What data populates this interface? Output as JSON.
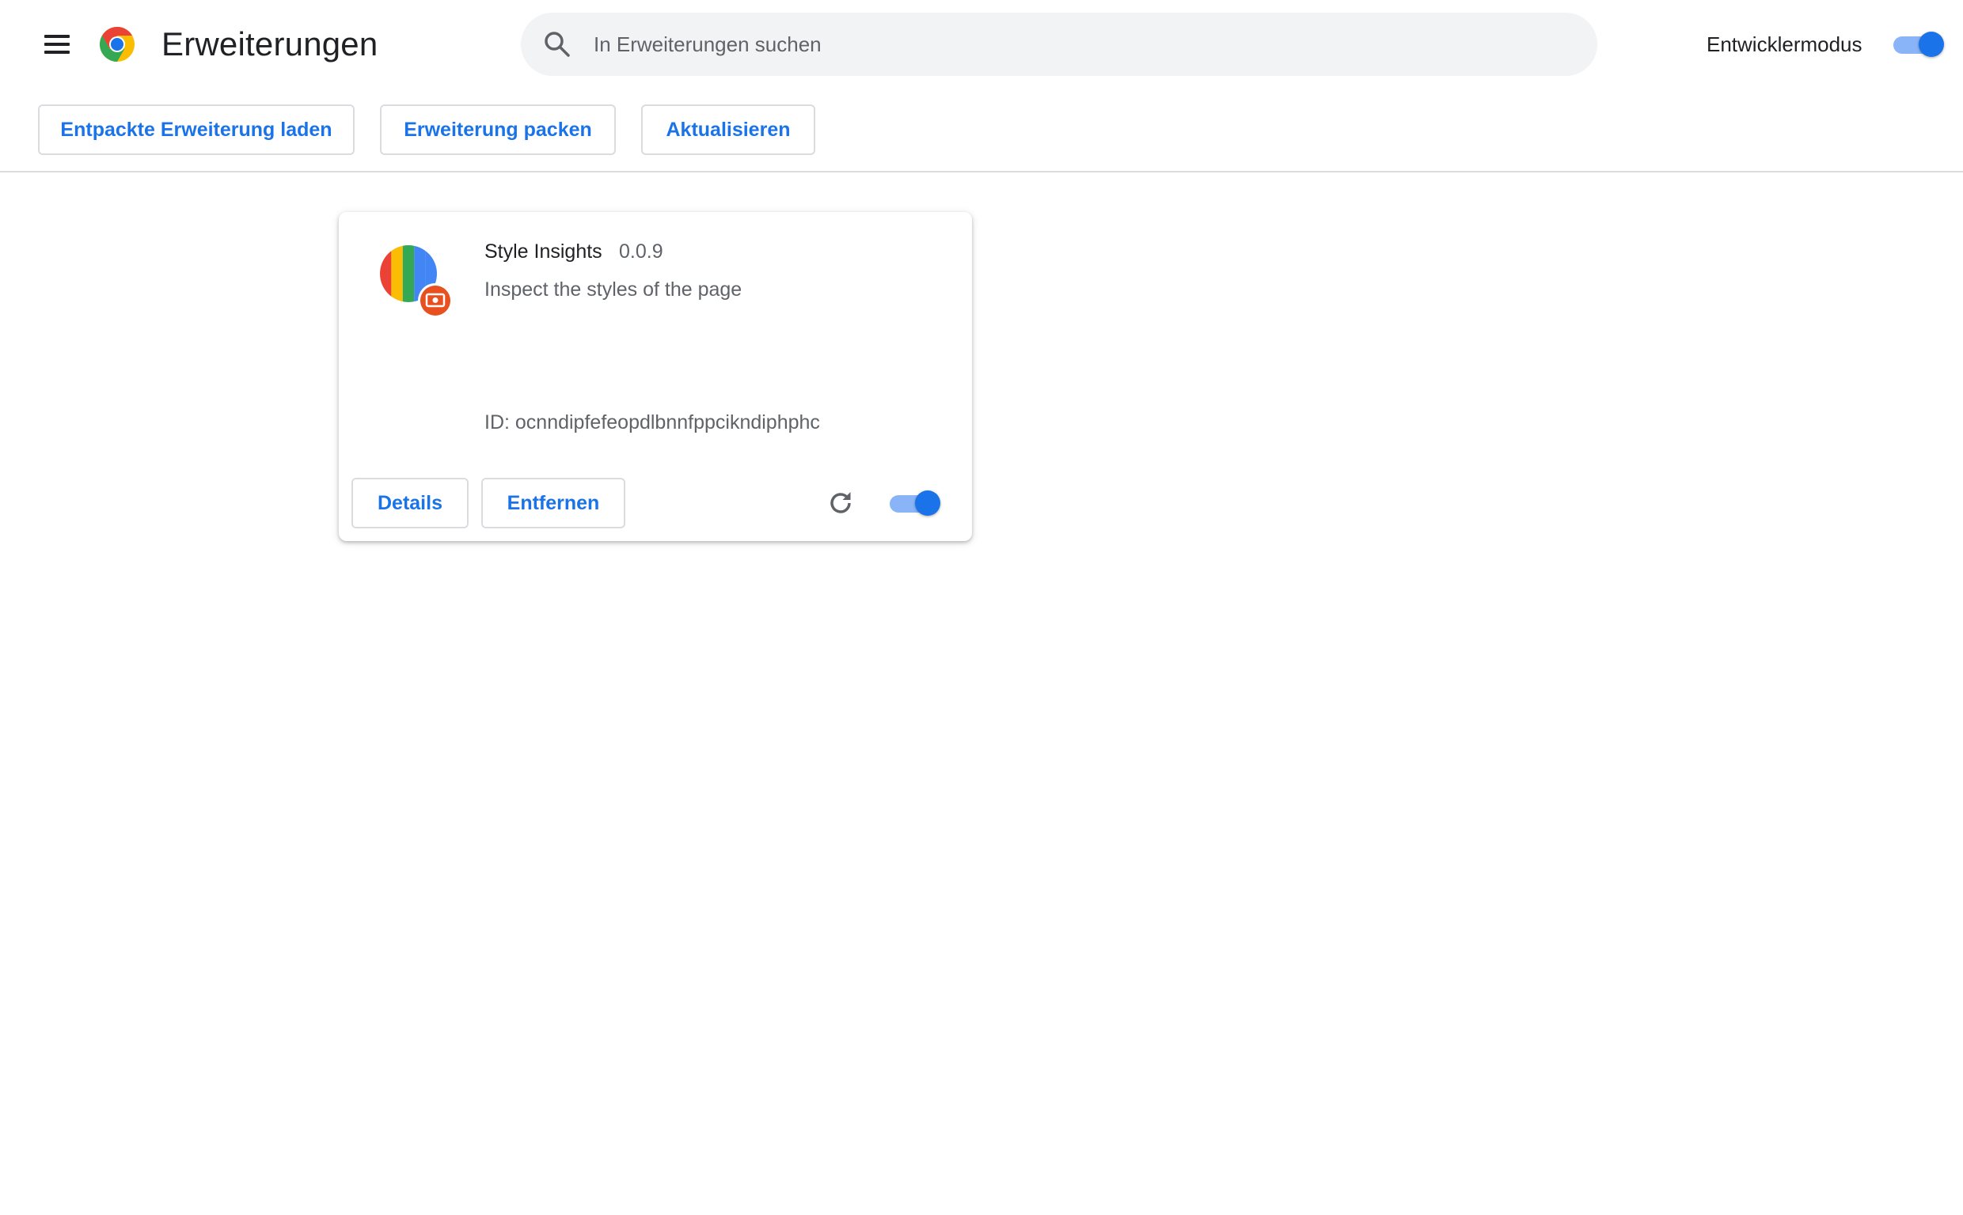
{
  "header": {
    "menu_icon": "hamburger-menu-icon",
    "logo_icon": "chrome-logo",
    "title": "Erweiterungen",
    "search": {
      "placeholder": "In Erweiterungen suchen",
      "value": "",
      "icon": "search-icon"
    },
    "developer_mode": {
      "label": "Entwicklermodus",
      "enabled": true
    }
  },
  "toolbar": {
    "load_unpacked_label": "Entpackte Erweiterung laden",
    "pack_label": "Erweiterung packen",
    "update_label": "Aktualisieren"
  },
  "extensions": [
    {
      "name": "Style Insights",
      "version": "0.0.9",
      "description": "Inspect the styles of the page",
      "id_text": "ID: ocnndipfefeopdlbnnfppcikndiphphc",
      "details_label": "Details",
      "remove_label": "Entfernen",
      "reload_icon": "reload-icon",
      "enabled": true
    }
  ],
  "colors": {
    "accent": "#1a73e8",
    "toggle_track": "#8ab4f8",
    "search_bg": "#f1f3f4",
    "border": "#dadce0",
    "text_primary": "#202124",
    "text_secondary": "#5f6368"
  }
}
